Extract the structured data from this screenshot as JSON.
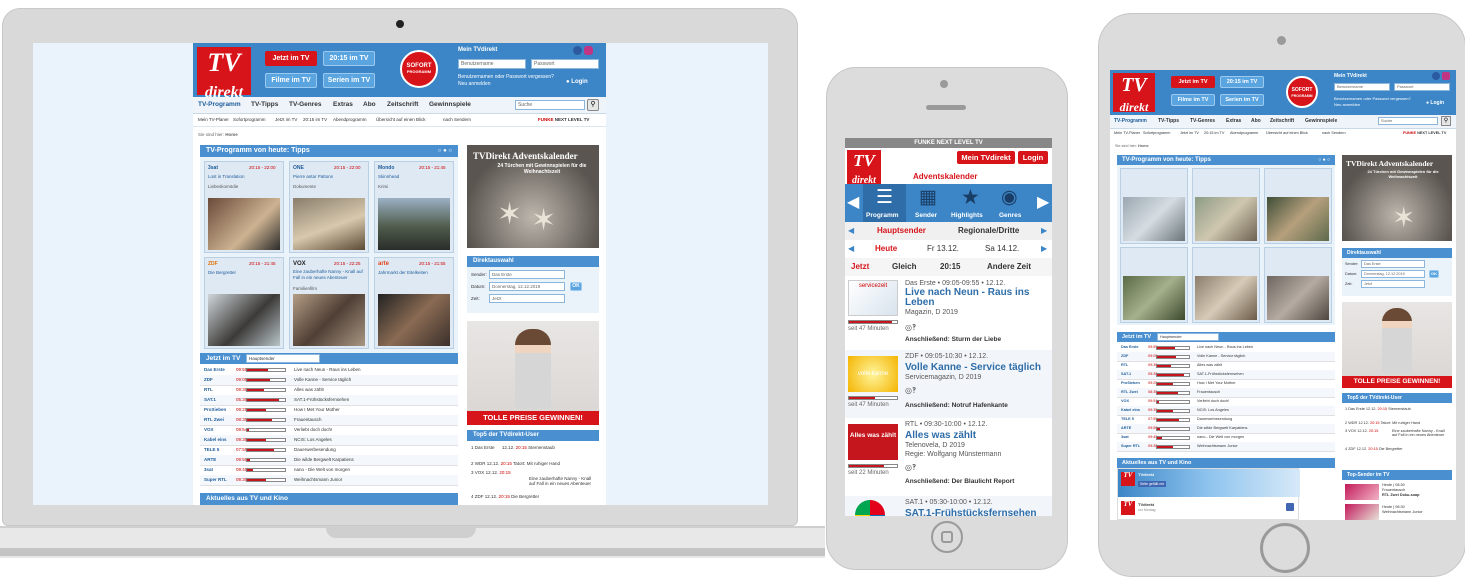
{
  "site": {
    "logo_line1": "TV",
    "logo_line2": "direkt",
    "nav_buttons": [
      "Jetzt im TV",
      "20:15 im TV",
      "Filme im TV",
      "Serien im TV"
    ],
    "sofort_top": "SOFORT",
    "sofort_bottom": "PROGRAMM",
    "login_title": "Mein TVdirekt",
    "user_placeholder": "Benutzername",
    "pass_placeholder": "Passwort",
    "forgot": "Benutzernamen oder Passwort vergessen?",
    "register": "Neu anmelden",
    "login_btn": "Login",
    "menu": [
      "TV-Programm",
      "TV-Tipps",
      "TV-Genres",
      "Extras",
      "Abo",
      "Zeitschrift",
      "Gewinnspiele"
    ],
    "search_placeholder": "Suche",
    "submenu": [
      "Mein TV-Planer",
      "Sofortprogramm",
      "Jetzt im TV",
      "20:15 im TV",
      "Abendprogramm",
      "Übersicht auf einen Blick",
      "nach Sendern"
    ],
    "funke": "FUNKE",
    "next_level": "NEXT LEVEL TV",
    "breadcrumb_label": "Sie sind hier:",
    "breadcrumb_home": "Home",
    "tips_title": "TV-Programm von heute: Tipps",
    "tips": [
      {
        "channel": "3sat",
        "time": "20:15 - 22:00",
        "title": "Lost in Translation",
        "genre": "Liebeskomödie"
      },
      {
        "channel": "ONE",
        "time": "20:15 - 22:00",
        "title": "Pierre antar Pattons",
        "genre": "Dokumente"
      },
      {
        "channel": "Mondo",
        "time": "20:15 - 21:45",
        "title": "Skinnhead",
        "genre": "Krimi"
      },
      {
        "channel": "ZDF",
        "time": "20:15 - 21:45",
        "title": "Die Bergretter",
        "genre": ""
      },
      {
        "channel": "VOX",
        "time": "20:15 - 22:25",
        "title": "Eine zauberhafte Nanny - Knall auf Fall in ein neues Abenteuer",
        "genre": "Familienfilm"
      },
      {
        "channel": "arte",
        "time": "20:15 - 21:55",
        "title": "Jahrmarkt der Eitelkeiten",
        "genre": ""
      }
    ],
    "advent_title": "TVDirekt Adventskalender",
    "advent_sub": "24 Türchen mit Gewinnspielen für die Weihnachtszeit",
    "direkt_title": "Direktauswahl",
    "sender_label": "Sender:",
    "sender_value": "Das Erste",
    "datum_label": "Datum:",
    "datum_value": "Donnerstag, 12.12.2019",
    "zeit_label": "Zeit:",
    "zeit_value": "Jetzt",
    "ok": "OK",
    "prize": "TOLLE PREISE GEWINNEN!",
    "jetzt_title": "Jetzt im TV",
    "jetzt_select": "Hauptsender",
    "now_rows": [
      {
        "ch": "Das Erste",
        "t": "09:55",
        "p": 0.55,
        "title": "Live nach Neun - Raus ins Leben"
      },
      {
        "ch": "ZDF",
        "t": "09:05",
        "p": 0.6,
        "title": "Volle Kanne - Service täglich"
      },
      {
        "ch": "RTL",
        "t": "09:30",
        "p": 0.45,
        "title": "Alles was zählt"
      },
      {
        "ch": "SAT.1",
        "t": "05:30",
        "p": 0.85,
        "title": "SAT.1-Frühstücksfernsehen"
      },
      {
        "ch": "ProSieben",
        "t": "09:25",
        "p": 0.5,
        "title": "How I Met Your Mother"
      },
      {
        "ch": "RTL Zwei",
        "t": "08:35",
        "p": 0.65,
        "title": "Frauentausch"
      },
      {
        "ch": "VOX",
        "t": "09:54",
        "p": 0.05,
        "title": "Verliebt doch doch!"
      },
      {
        "ch": "Kabel eins",
        "t": "09:35",
        "p": 0.5,
        "title": "NCIS: Los Angeles"
      },
      {
        "ch": "TELE 5",
        "t": "07:55",
        "p": 0.7,
        "title": "Dauerwerbesendung"
      },
      {
        "ch": "ARTE",
        "t": "09:50",
        "p": 0.08,
        "title": "Die wilde Bergwelt Karpatiens"
      },
      {
        "ch": "3sat",
        "t": "09:45",
        "p": 0.15,
        "title": "nano - Die Welt von morgen"
      },
      {
        "ch": "Super RTL",
        "t": "09:30",
        "p": 0.5,
        "title": "Weihnachtsmann Junior"
      }
    ],
    "top_title": "Top5 der TVdirekt-User",
    "top": [
      {
        "n": "1",
        "ch": "Das Erste",
        "d": "12.12.",
        "t": "20:15",
        "title": "Sternenstaub"
      },
      {
        "n": "2",
        "ch": "WDR",
        "d": "12.12.",
        "t": "20:15",
        "title": "Tatort: Mit ruhiger Hand"
      },
      {
        "n": "3",
        "ch": "VOX",
        "d": "12.12.",
        "t": "20:15",
        "title": "Eine zauberhafte Nanny - Knall auf Fall in ein neues Abenteuer"
      },
      {
        "n": "4",
        "ch": "ZDF",
        "d": "12.12.",
        "t": "20:15",
        "title": "Die Bergretter"
      }
    ],
    "news_title": "Aktuelles aus TV und Kino"
  },
  "mobile": {
    "funke": "FUNKE",
    "next_level": "NEXT LEVEL TV",
    "mein": "Mein TVdirekt",
    "login": "Login",
    "advent": "Adventskalender",
    "icons": [
      "Programm",
      "Sender",
      "Highlights",
      "Genres"
    ],
    "sender_tabs": [
      "Hauptsender",
      "Regionale/Dritte"
    ],
    "days": [
      "Heute",
      "Fr 13.12.",
      "Sa 14.12."
    ],
    "times": [
      "Jetzt",
      "Gleich",
      "20:15",
      "Andere Zeit"
    ],
    "shows": [
      {
        "logo": "servicezeit",
        "meta": "Das Erste • 09:05-09:55 • 12.12.",
        "title": "Live nach Neun - Raus ins Leben",
        "genre": "Magazin, D 2019",
        "left": "seit 47 Minuten",
        "next": "Anschließend: Sturm der Liebe"
      },
      {
        "logo": "volle kanne",
        "meta": "ZDF • 09:05-10:30 • 12.12.",
        "title": "Volle Kanne - Service täglich",
        "genre": "Servicemagazin, D 2019",
        "left": "seit 47 Minuten",
        "next": "Anschließend: Notruf Hafenkante"
      },
      {
        "logo": "Alles was zählt",
        "meta": "RTL • 09:30-10:00 • 12.12.",
        "title": "Alles was zählt",
        "genre": "Telenovela, D 2019",
        "extra": "Regie: Wolfgang Münstermann",
        "left": "seit 22 Minuten",
        "next": "Anschließend: Der Blaulicht Report"
      },
      {
        "logo": "SAT.1",
        "meta": "SAT.1 • 05:30-10:00 • 12.12.",
        "title": "SAT.1-Frühstücksfernsehen",
        "genre": "",
        "left": "",
        "next": ""
      }
    ]
  },
  "tablet": {
    "news_brand": "TVdirekt",
    "news_date": "vor Montag",
    "page_btn": "Seite gefällt mir",
    "top_sender_title": "Top-Sender im TV",
    "top_sender_rows": [
      {
        "line1": "Heute | 08:30",
        "line2": "Frauentausch",
        "line3": "RTL Zwei Doku-soap"
      },
      {
        "line1": "Heute | 08:30",
        "line2": "Weihnachtsmann Junior",
        "line3": ""
      }
    ]
  },
  "colors": {
    "brand_red": "#d7141a",
    "brand_blue": "#3c86c7",
    "bar_blue": "#4a90d0"
  }
}
